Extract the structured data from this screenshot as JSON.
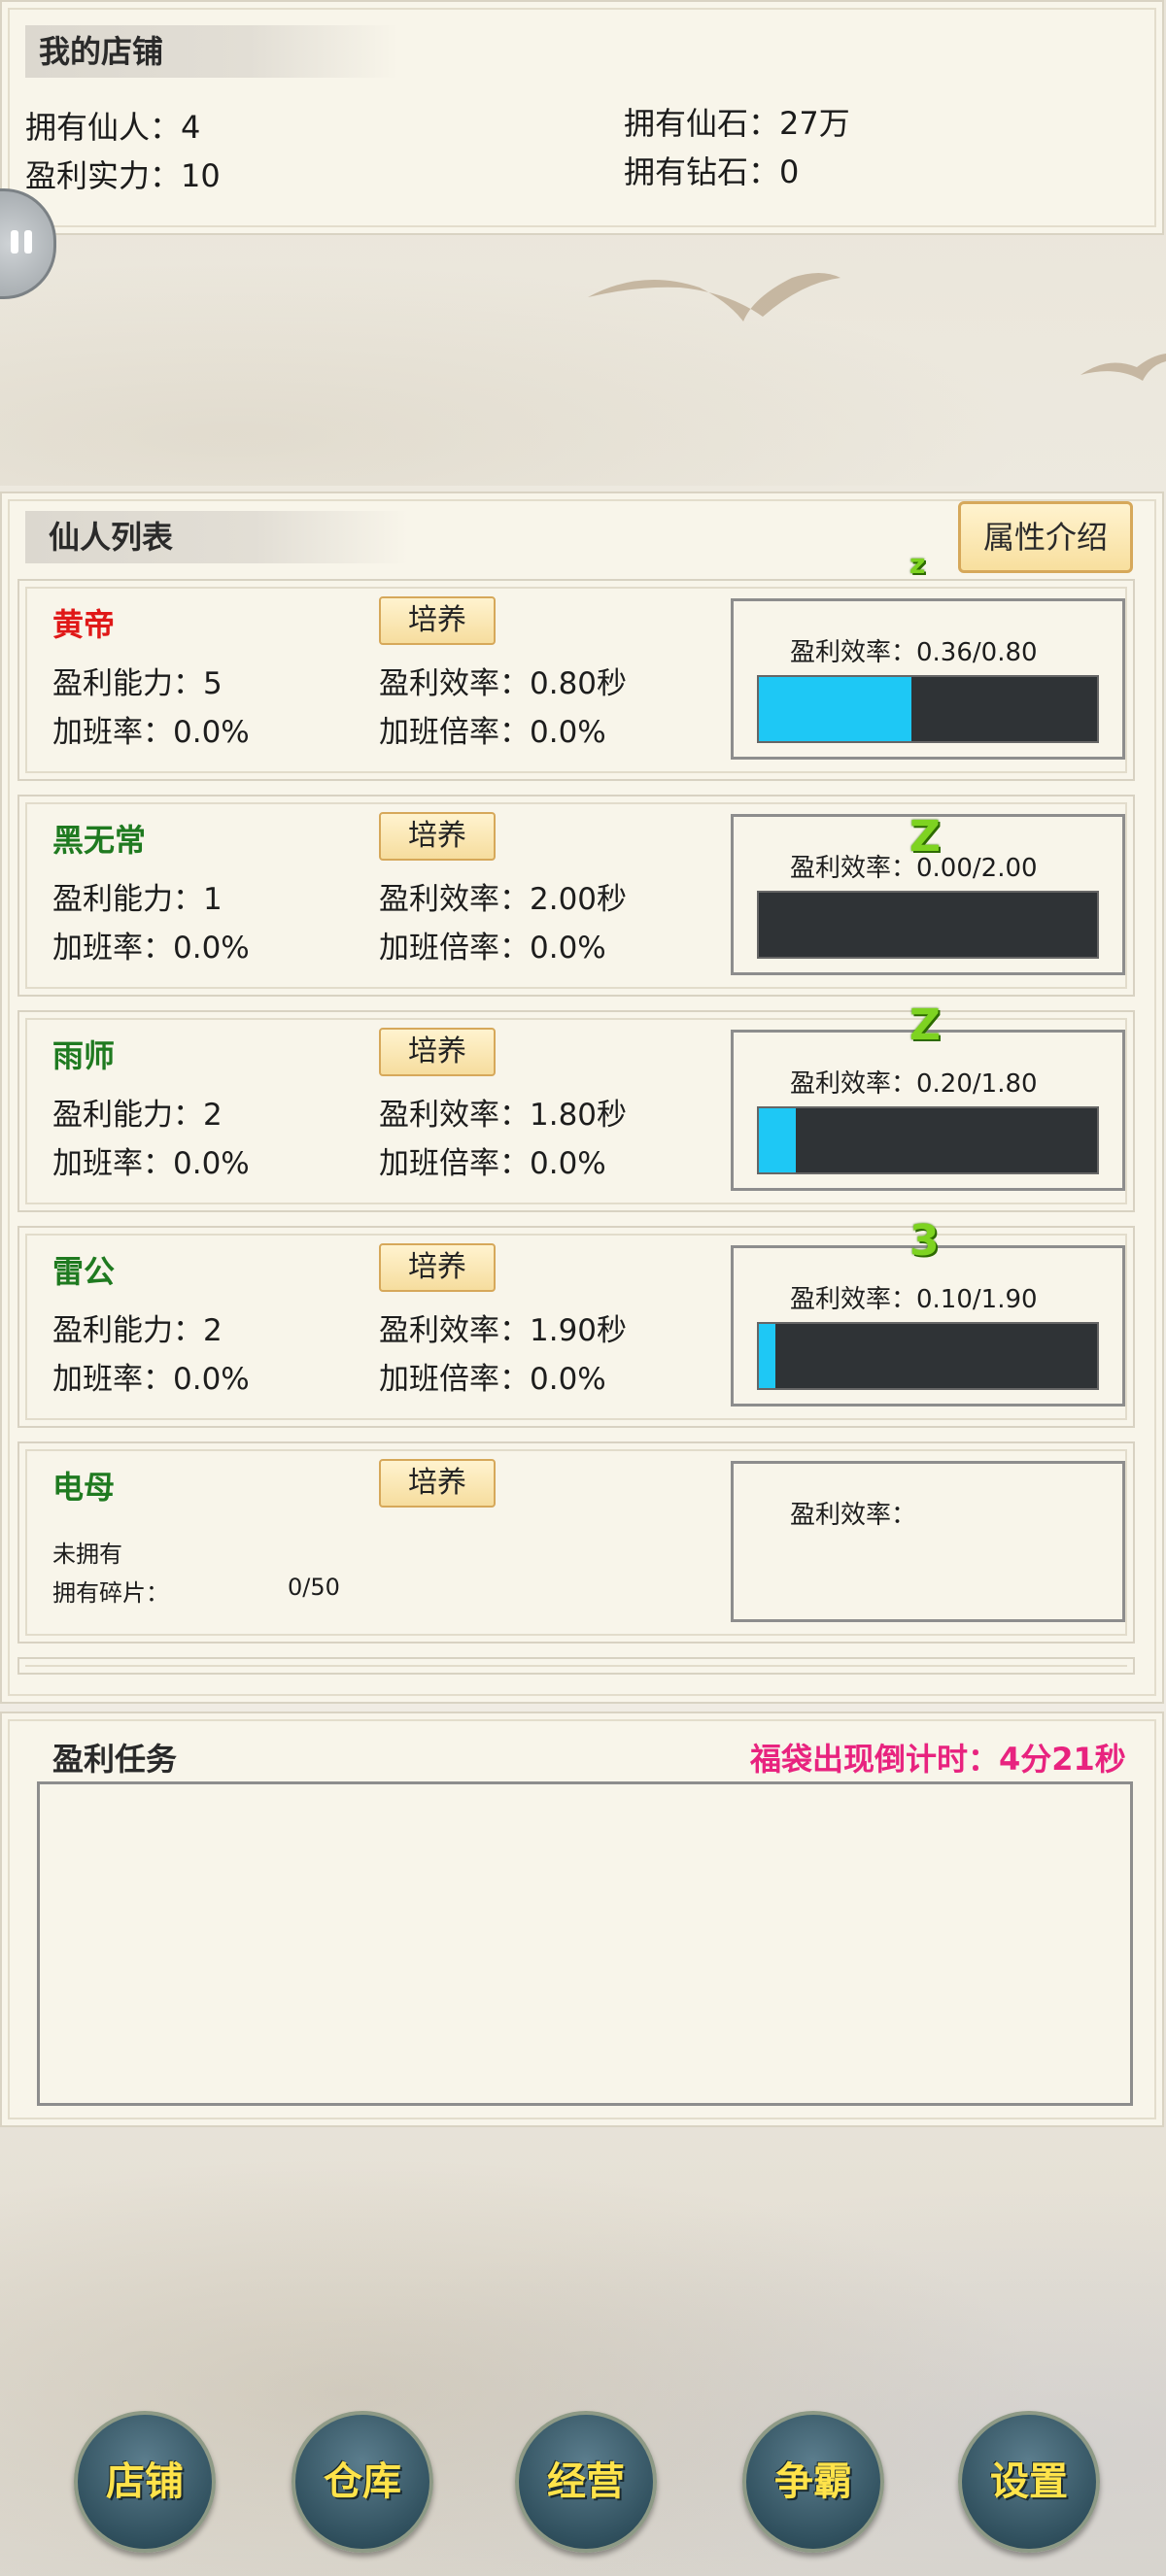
{
  "shop": {
    "title": "我的店铺",
    "immortals": "拥有仙人：4",
    "spirit_stones": "拥有仙石：27万",
    "profit_power": "盈利实力：10",
    "diamonds": "拥有钻石：0"
  },
  "list": {
    "title": "仙人列表",
    "attr_button": "属性介绍",
    "cards": [
      {
        "name": "黄帝",
        "name_color": "red",
        "train": "培养",
        "ability": "盈利能力：5",
        "efficiency": "盈利效率：0.80秒",
        "overtime": "加班率：0.0%",
        "overtime_mult": "加班倍率：0.0%",
        "eff_label": "盈利效率：0.36/0.80",
        "progress": 0.45,
        "zz": "z"
      },
      {
        "name": "黑无常",
        "name_color": "green",
        "train": "培养",
        "ability": "盈利能力：1",
        "efficiency": "盈利效率：2.00秒",
        "overtime": "加班率：0.0%",
        "overtime_mult": "加班倍率：0.0%",
        "eff_label": "盈利效率：0.00/2.00",
        "progress": 0.0,
        "zz": "Z"
      },
      {
        "name": "雨师",
        "name_color": "green",
        "train": "培养",
        "ability": "盈利能力：2",
        "efficiency": "盈利效率：1.80秒",
        "overtime": "加班率：0.0%",
        "overtime_mult": "加班倍率：0.0%",
        "eff_label": "盈利效率：0.20/1.80",
        "progress": 0.11,
        "zz": "Z"
      },
      {
        "name": "雷公",
        "name_color": "green",
        "train": "培养",
        "ability": "盈利能力：2",
        "efficiency": "盈利效率：1.90秒",
        "overtime": "加班率：0.0%",
        "overtime_mult": "加班倍率：0.0%",
        "eff_label": "盈利效率：0.10/1.90",
        "progress": 0.05,
        "zz": "3"
      },
      {
        "name": "电母",
        "name_color": "green",
        "train": "培养",
        "status": "未拥有",
        "fragments_label": "拥有碎片：",
        "fragments_value": "0/50",
        "eff_label": "盈利效率："
      }
    ]
  },
  "task": {
    "title": "盈利任务",
    "countdown": "福袋出现倒计时：4分21秒"
  },
  "nav": [
    "店铺",
    "仓库",
    "经营",
    "争霸",
    "设置"
  ]
}
